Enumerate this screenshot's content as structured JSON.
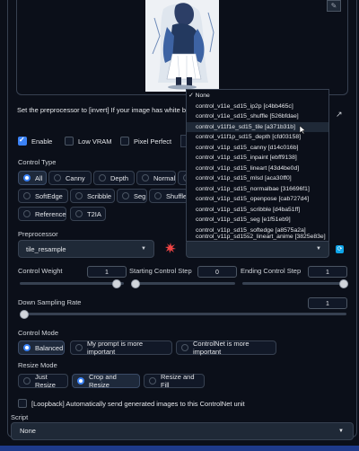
{
  "hint_text": "Set the preprocessor to [invert] If your image has white background and black lines",
  "checks": {
    "enable": "Enable",
    "low_vram": "Low VRAM",
    "pixel_perfect": "Pixel Perfect"
  },
  "control_type": {
    "title": "Control Type",
    "options": [
      "All",
      "Canny",
      "Depth",
      "Normal",
      "SoftEdge",
      "Scribble",
      "Seg",
      "Shuffle",
      "Reference",
      "T2IA"
    ],
    "selected": "All"
  },
  "preprocessor": {
    "title": "Preprocessor",
    "value": "tile_resample",
    "model_value": ""
  },
  "control_weight": {
    "label": "Control Weight",
    "value": "1",
    "fraction": 0.95
  },
  "start_step": {
    "label": "Starting Control Step",
    "value": "0",
    "fraction": 0.0
  },
  "end_step": {
    "label": "Ending Control Step",
    "value": "1",
    "fraction": 1.0
  },
  "down_sampling": {
    "label": "Down Sampling Rate",
    "value": "1",
    "fraction": 0.0
  },
  "control_mode": {
    "title": "Control Mode",
    "options": [
      "Balanced",
      "My prompt is more important",
      "ControlNet is more important"
    ],
    "selected": "Balanced"
  },
  "resize_mode": {
    "title": "Resize Mode",
    "options": [
      "Just Resize",
      "Crop and Resize",
      "Resize and Fill"
    ],
    "selected": "Crop and Resize"
  },
  "loopback": "[Loopback] Automatically send generated images to this ControlNet unit",
  "script": {
    "title": "Script",
    "value": "None"
  },
  "model_dropdown": {
    "items": [
      "None",
      "control_v11e_sd15_ip2p [c4bb465c]",
      "control_v11e_sd15_shuffle [526bfdae]",
      "control_v11f1e_sd15_tile [a371b31b]",
      "control_v11f1p_sd15_depth [cfd03158]",
      "control_v11p_sd15_canny [d14c016b]",
      "control_v11p_sd15_inpaint [ebff9138]",
      "control_v11p_sd15_lineart [43d4be0d]",
      "control_v11p_sd15_mlsd [aca30ff0]",
      "control_v11p_sd15_normalbae [316696f1]",
      "control_v11p_sd15_openpose [cab727d4]",
      "control_v11p_sd15_scribble [d4ba51ff]",
      "control_v11p_sd15_seg [e1f51eb9]",
      "control_v11p_sd15_softedge [a8575a2a]",
      "control_v11p_sd15s2_lineart_anime [3825e83e]"
    ],
    "checked": "None",
    "highlighted": "control_v11f1e_sd15_tile [a371b31b]"
  },
  "colors": {
    "accent": "#3b82f6",
    "background": "#0b0f19",
    "panel_border": "#374151"
  },
  "icons": {
    "spark": "red-burst-icon",
    "refresh": "refresh-icon",
    "swap": "swap-icon"
  }
}
